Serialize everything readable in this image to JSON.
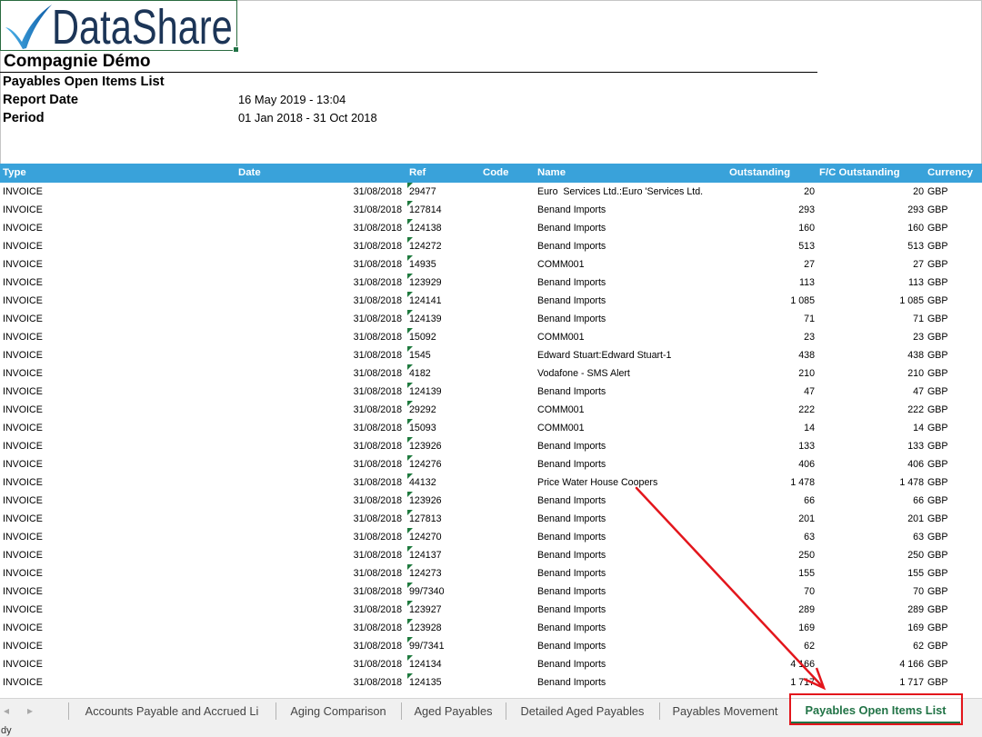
{
  "logo": {
    "text": "DataShare",
    "text_color": "#1c3557",
    "check_colors": [
      "#4cb3ea",
      "#0c5aa5"
    ]
  },
  "report": {
    "company": "Compagnie Démo",
    "title": "Payables Open Items List",
    "report_date_label": "Report Date",
    "report_date_value": "16 May 2019 - 13:04",
    "period_label": "Period",
    "period_value": "01 Jan 2018 - 31 Oct 2018"
  },
  "table": {
    "header_color": "#39a2da",
    "columns": {
      "type": "Type",
      "date": "Date",
      "ref": "Ref",
      "code": "Code",
      "name": "Name",
      "outstanding": "Outstanding",
      "fc_outstanding": "F/C Outstanding",
      "currency": "Currency"
    },
    "rows": [
      {
        "type": "INVOICE",
        "date": "31/08/2018",
        "ref": "29477",
        "name": "Euro  Services Ltd.:Euro 'Services Ltd.",
        "outstanding": "20",
        "fc_outstanding": "20",
        "currency": "GBP"
      },
      {
        "type": "INVOICE",
        "date": "31/08/2018",
        "ref": "127814",
        "name": "Benand Imports",
        "outstanding": "293",
        "fc_outstanding": "293",
        "currency": "GBP"
      },
      {
        "type": "INVOICE",
        "date": "31/08/2018",
        "ref": "124138",
        "name": "Benand Imports",
        "outstanding": "160",
        "fc_outstanding": "160",
        "currency": "GBP"
      },
      {
        "type": "INVOICE",
        "date": "31/08/2018",
        "ref": "124272",
        "name": "Benand Imports",
        "outstanding": "513",
        "fc_outstanding": "513",
        "currency": "GBP"
      },
      {
        "type": "INVOICE",
        "date": "31/08/2018",
        "ref": "14935",
        "name": "COMM001",
        "outstanding": "27",
        "fc_outstanding": "27",
        "currency": "GBP"
      },
      {
        "type": "INVOICE",
        "date": "31/08/2018",
        "ref": "123929",
        "name": "Benand Imports",
        "outstanding": "113",
        "fc_outstanding": "113",
        "currency": "GBP"
      },
      {
        "type": "INVOICE",
        "date": "31/08/2018",
        "ref": "124141",
        "name": "Benand Imports",
        "outstanding": "1 085",
        "fc_outstanding": "1 085",
        "currency": "GBP"
      },
      {
        "type": "INVOICE",
        "date": "31/08/2018",
        "ref": "124139",
        "name": "Benand Imports",
        "outstanding": "71",
        "fc_outstanding": "71",
        "currency": "GBP"
      },
      {
        "type": "INVOICE",
        "date": "31/08/2018",
        "ref": "15092",
        "name": "COMM001",
        "outstanding": "23",
        "fc_outstanding": "23",
        "currency": "GBP"
      },
      {
        "type": "INVOICE",
        "date": "31/08/2018",
        "ref": "1545",
        "name": "Edward Stuart:Edward Stuart-1",
        "outstanding": "438",
        "fc_outstanding": "438",
        "currency": "GBP"
      },
      {
        "type": "INVOICE",
        "date": "31/08/2018",
        "ref": "4182",
        "name": "Vodafone - SMS Alert",
        "outstanding": "210",
        "fc_outstanding": "210",
        "currency": "GBP"
      },
      {
        "type": "INVOICE",
        "date": "31/08/2018",
        "ref": "124139",
        "name": "Benand Imports",
        "outstanding": "47",
        "fc_outstanding": "47",
        "currency": "GBP"
      },
      {
        "type": "INVOICE",
        "date": "31/08/2018",
        "ref": "29292",
        "name": "COMM001",
        "outstanding": "222",
        "fc_outstanding": "222",
        "currency": "GBP"
      },
      {
        "type": "INVOICE",
        "date": "31/08/2018",
        "ref": "15093",
        "name": "COMM001",
        "outstanding": "14",
        "fc_outstanding": "14",
        "currency": "GBP"
      },
      {
        "type": "INVOICE",
        "date": "31/08/2018",
        "ref": "123926",
        "name": "Benand Imports",
        "outstanding": "133",
        "fc_outstanding": "133",
        "currency": "GBP"
      },
      {
        "type": "INVOICE",
        "date": "31/08/2018",
        "ref": "124276",
        "name": "Benand Imports",
        "outstanding": "406",
        "fc_outstanding": "406",
        "currency": "GBP"
      },
      {
        "type": "INVOICE",
        "date": "31/08/2018",
        "ref": "44132",
        "name": "Price Water House Coopers",
        "outstanding": "1 478",
        "fc_outstanding": "1 478",
        "currency": "GBP"
      },
      {
        "type": "INVOICE",
        "date": "31/08/2018",
        "ref": "123926",
        "name": "Benand Imports",
        "outstanding": "66",
        "fc_outstanding": "66",
        "currency": "GBP"
      },
      {
        "type": "INVOICE",
        "date": "31/08/2018",
        "ref": "127813",
        "name": "Benand Imports",
        "outstanding": "201",
        "fc_outstanding": "201",
        "currency": "GBP"
      },
      {
        "type": "INVOICE",
        "date": "31/08/2018",
        "ref": "124270",
        "name": "Benand Imports",
        "outstanding": "63",
        "fc_outstanding": "63",
        "currency": "GBP"
      },
      {
        "type": "INVOICE",
        "date": "31/08/2018",
        "ref": "124137",
        "name": "Benand Imports",
        "outstanding": "250",
        "fc_outstanding": "250",
        "currency": "GBP"
      },
      {
        "type": "INVOICE",
        "date": "31/08/2018",
        "ref": "124273",
        "name": "Benand Imports",
        "outstanding": "155",
        "fc_outstanding": "155",
        "currency": "GBP"
      },
      {
        "type": "INVOICE",
        "date": "31/08/2018",
        "ref": "99/7340",
        "name": "Benand Imports",
        "outstanding": "70",
        "fc_outstanding": "70",
        "currency": "GBP"
      },
      {
        "type": "INVOICE",
        "date": "31/08/2018",
        "ref": "123927",
        "name": "Benand Imports",
        "outstanding": "289",
        "fc_outstanding": "289",
        "currency": "GBP"
      },
      {
        "type": "INVOICE",
        "date": "31/08/2018",
        "ref": "123928",
        "name": "Benand Imports",
        "outstanding": "169",
        "fc_outstanding": "169",
        "currency": "GBP"
      },
      {
        "type": "INVOICE",
        "date": "31/08/2018",
        "ref": "99/7341",
        "name": "Benand Imports",
        "outstanding": "62",
        "fc_outstanding": "62",
        "currency": "GBP"
      },
      {
        "type": "INVOICE",
        "date": "31/08/2018",
        "ref": "124134",
        "name": "Benand Imports",
        "outstanding": "4 166",
        "fc_outstanding": "4 166",
        "currency": "GBP"
      },
      {
        "type": "INVOICE",
        "date": "31/08/2018",
        "ref": "124135",
        "name": "Benand Imports",
        "outstanding": "1 717",
        "fc_outstanding": "1 717",
        "currency": "GBP"
      }
    ]
  },
  "sheet_tabs": {
    "nav_prev": "◂",
    "nav_next": "▸",
    "active_color": "#217346",
    "tabs": [
      {
        "label": "Accounts Payable and Accrued Li",
        "active": false
      },
      {
        "label": "Aging Comparison",
        "active": false
      },
      {
        "label": "Aged Payables",
        "active": false
      },
      {
        "label": "Detailed Aged Payables",
        "active": false
      },
      {
        "label": "Payables Movement",
        "active": false
      },
      {
        "label": "Payables Open Items List",
        "active": true
      }
    ]
  },
  "status_bar": {
    "text": "dy"
  },
  "annotation": {
    "color": "#e3161c"
  }
}
